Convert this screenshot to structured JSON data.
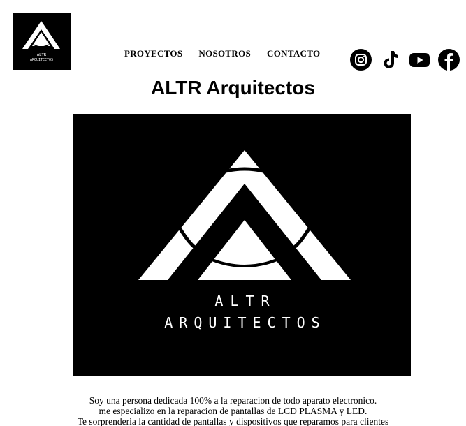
{
  "header": {
    "logo_small": {
      "line1": "ALTR",
      "line2": "ARQUITECTOS"
    },
    "nav": [
      {
        "label": "PROYECTOS"
      },
      {
        "label": "NOSOTROS"
      },
      {
        "label": "CONTACTO"
      }
    ],
    "social_icons": [
      "instagram-icon",
      "tiktok-icon",
      "youtube-icon",
      "facebook-icon"
    ]
  },
  "main": {
    "title": "ALTR Arquitectos",
    "hero": {
      "line1": "ALTR",
      "line2": "ARQUITECTOS"
    },
    "description": [
      "Soy una persona dedicada 100% a la reparacion de todo aparato electronico.",
      "me especializo en la reparacion de pantallas de LCD PLASMA y LED.",
      "Te sorprenderia la cantidad de pantallas y dispositivos que reparamos para clientes"
    ]
  },
  "colors": {
    "background": "#ffffff",
    "logo_bg": "#000000",
    "text": "#000000"
  }
}
